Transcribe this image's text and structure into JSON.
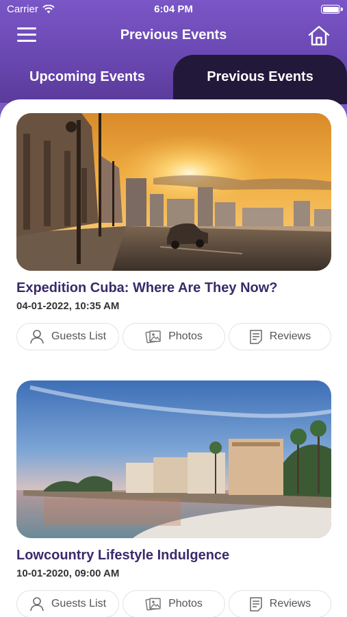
{
  "status_bar": {
    "carrier": "Carrier",
    "time": "6:04 PM"
  },
  "header": {
    "title": "Previous Events",
    "menu_icon": "hamburger-menu-icon",
    "home_icon": "home-icon"
  },
  "tabs": [
    {
      "label": "Upcoming Events",
      "active": false
    },
    {
      "label": "Previous Events",
      "active": true
    }
  ],
  "events": [
    {
      "title": "Expedition Cuba: Where Are They Now?",
      "date": "04-01-2022, 10:35 AM",
      "image": "havana-malecon-sunset-photo",
      "actions": {
        "guests": "Guests List",
        "photos": "Photos",
        "reviews": "Reviews"
      }
    },
    {
      "title": "Lowcountry Lifestyle Indulgence",
      "date": "10-01-2020, 09:00 AM",
      "image": "charleston-battery-waterfront-photo",
      "actions": {
        "guests": "Guests List",
        "photos": "Photos",
        "reviews": "Reviews"
      }
    }
  ],
  "colors": {
    "header": "#7a56c6",
    "active_tab": "#22183a",
    "title_text": "#3a2a6a"
  }
}
